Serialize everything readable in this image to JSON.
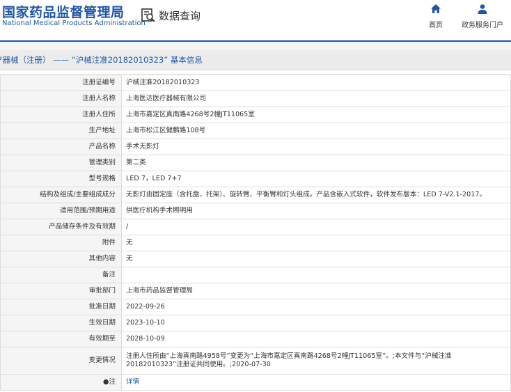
{
  "header": {
    "logo_cn": "国家药品监督管理局",
    "logo_en": "National Medical Products Administration",
    "query_label": "数据查询",
    "nav": {
      "home_label": "首页",
      "portal_label": "政务服务门户"
    }
  },
  "title": "疗器械（注册） —— “沪械注准20182010323” 基本信息",
  "rows": [
    {
      "label": "注册证编号",
      "value": "沪械注准20182010323"
    },
    {
      "label": "注册人名称",
      "value": "上海医达医疗器械有限公司"
    },
    {
      "label": "注册人住所",
      "value": "上海市嘉定区真南路4268号2幢JT11065室"
    },
    {
      "label": "生产地址",
      "value": "上海市松江区健鹏路108号"
    },
    {
      "label": "产品名称",
      "value": "手术无影灯"
    },
    {
      "label": "管理类别",
      "value": "第二类"
    },
    {
      "label": "型号规格",
      "value": "LED 7，LED 7+7"
    },
    {
      "label": "结构及组成/主要组成成分",
      "value": "无影灯由固定座（含托盘、托架）、旋转臂、平衡臂和灯头组成。产品含嵌入式软件，软件发布版本：LED 7-V2.1-2017。"
    },
    {
      "label": "适用范围/预期用途",
      "value": "供医疗机构手术照明用"
    },
    {
      "label": "产品储存条件及有效期",
      "value": "/"
    },
    {
      "label": "附件",
      "value": "无"
    },
    {
      "label": "其他内容",
      "value": "无"
    },
    {
      "label": "备注",
      "value": ""
    },
    {
      "label": "审批部门",
      "value": "上海市药品监督管理局"
    },
    {
      "label": "批准日期",
      "value": "2022-09-26"
    },
    {
      "label": "生效日期",
      "value": "2023-10-10"
    },
    {
      "label": "有效期至",
      "value": "2028-10-09"
    },
    {
      "label": "变更情况",
      "value": "注册人住所由“上海真南路4958号”变更为“上海市嘉定区真南路4268号2幢JT11065室”。;本文件与“沪械注准20182010323”注册证共同使用。;2020-07-30"
    },
    {
      "label": "●注",
      "value": "详情"
    }
  ]
}
